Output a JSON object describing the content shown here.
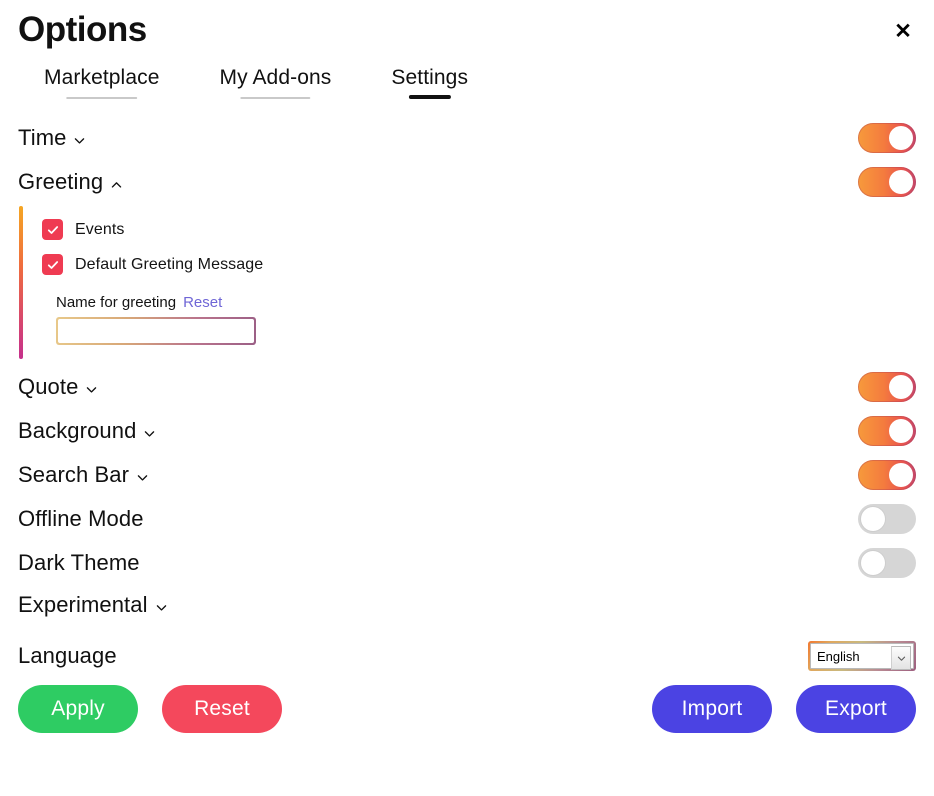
{
  "window": {
    "title": "Options",
    "close_icon": "close-icon",
    "close_label": "✕"
  },
  "tabs": [
    {
      "label": "Marketplace",
      "active": false
    },
    {
      "label": "My Add-ons",
      "active": false
    },
    {
      "label": "Settings",
      "active": true
    }
  ],
  "colors": {
    "toggle_on_start": "#f79a3c",
    "toggle_on_end": "#c3476b",
    "toggle_off": "#d6d6d6",
    "checkbox": "#ef3b52",
    "accent_bar_start": "#f5a623",
    "accent_bar_end": "#c5308c",
    "link": "#6f66d6",
    "apply": "#2ecc63",
    "reset": "#f4485c",
    "import_export": "#4b43e3",
    "tab_active_underline": "#111111",
    "tab_inactive_underline": "#c9c9c9"
  },
  "settings": {
    "time": {
      "label": "Time",
      "chevron": "chevron-down-icon",
      "toggle": "on"
    },
    "greeting": {
      "label": "Greeting",
      "chevron": "chevron-up-icon",
      "toggle": "on",
      "expanded": true,
      "checkboxes": [
        {
          "label": "Events",
          "checked": true
        },
        {
          "label": "Default Greeting Message",
          "checked": true
        }
      ],
      "name_field": {
        "label": "Name for greeting",
        "reset_label": "Reset",
        "value": "",
        "placeholder": ""
      }
    },
    "quote": {
      "label": "Quote",
      "chevron": "chevron-down-icon",
      "toggle": "on"
    },
    "background": {
      "label": "Background",
      "chevron": "chevron-down-icon",
      "toggle": "on"
    },
    "search_bar": {
      "label": "Search Bar",
      "chevron": "chevron-down-icon",
      "toggle": "on"
    },
    "offline_mode": {
      "label": "Offline Mode",
      "chevron": null,
      "toggle": "off"
    },
    "dark_theme": {
      "label": "Dark Theme",
      "chevron": null,
      "toggle": "off"
    },
    "experimental": {
      "label": "Experimental",
      "chevron": "chevron-down-icon",
      "toggle": null
    },
    "language": {
      "label": "Language",
      "selected": "English",
      "options": [
        "English"
      ],
      "arrow_icon": "chevron-down-icon"
    }
  },
  "footer": {
    "apply_label": "Apply",
    "reset_label": "Reset",
    "import_label": "Import",
    "export_label": "Export"
  }
}
